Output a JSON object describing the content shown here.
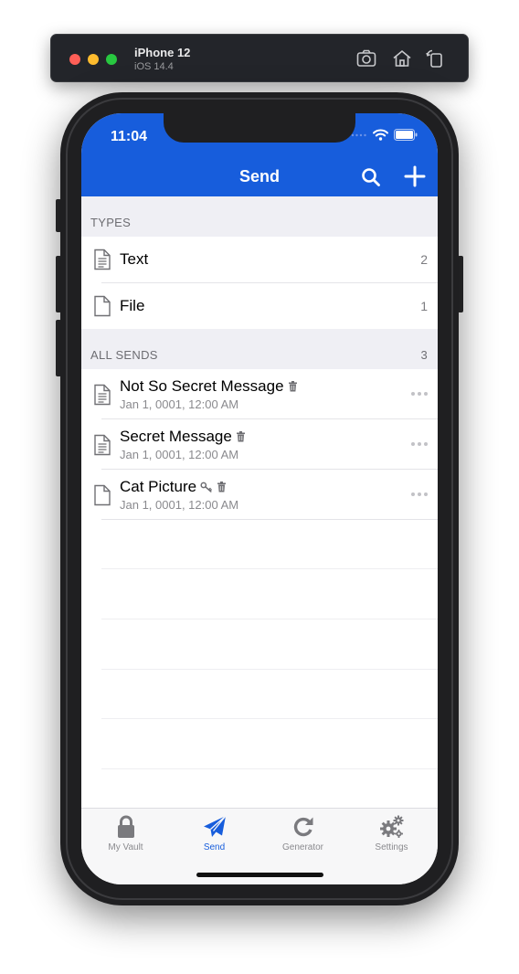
{
  "simulator": {
    "device": "iPhone 12",
    "os": "iOS 14.4"
  },
  "status_bar": {
    "time": "11:04"
  },
  "nav": {
    "title": "Send"
  },
  "types_section": {
    "header": "TYPES",
    "items": [
      {
        "label": "Text",
        "count": "2",
        "icon": "text-document-icon"
      },
      {
        "label": "File",
        "count": "1",
        "icon": "file-icon"
      }
    ]
  },
  "sends_section": {
    "header": "ALL SENDS",
    "count": "3",
    "items": [
      {
        "name": "Not So Secret Message",
        "date": "Jan 1, 0001, 12:00 AM",
        "icon": "text-document-icon",
        "badges": [
          "trash-icon"
        ]
      },
      {
        "name": "Secret Message",
        "date": "Jan 1, 0001, 12:00 AM",
        "icon": "text-document-icon",
        "badges": [
          "trash-icon"
        ]
      },
      {
        "name": "Cat Picture",
        "date": "Jan 1, 0001, 12:00 AM",
        "icon": "file-icon",
        "badges": [
          "key-icon",
          "trash-icon"
        ]
      }
    ]
  },
  "tabs": [
    {
      "label": "My Vault",
      "icon": "lock-icon",
      "active": false
    },
    {
      "label": "Send",
      "icon": "paper-plane-icon",
      "active": true
    },
    {
      "label": "Generator",
      "icon": "refresh-icon",
      "active": false
    },
    {
      "label": "Settings",
      "icon": "gears-icon",
      "active": false
    }
  ],
  "colors": {
    "brand": "#175ddc",
    "group_bg": "#efeff4",
    "muted_text": "#8a8a8e"
  }
}
